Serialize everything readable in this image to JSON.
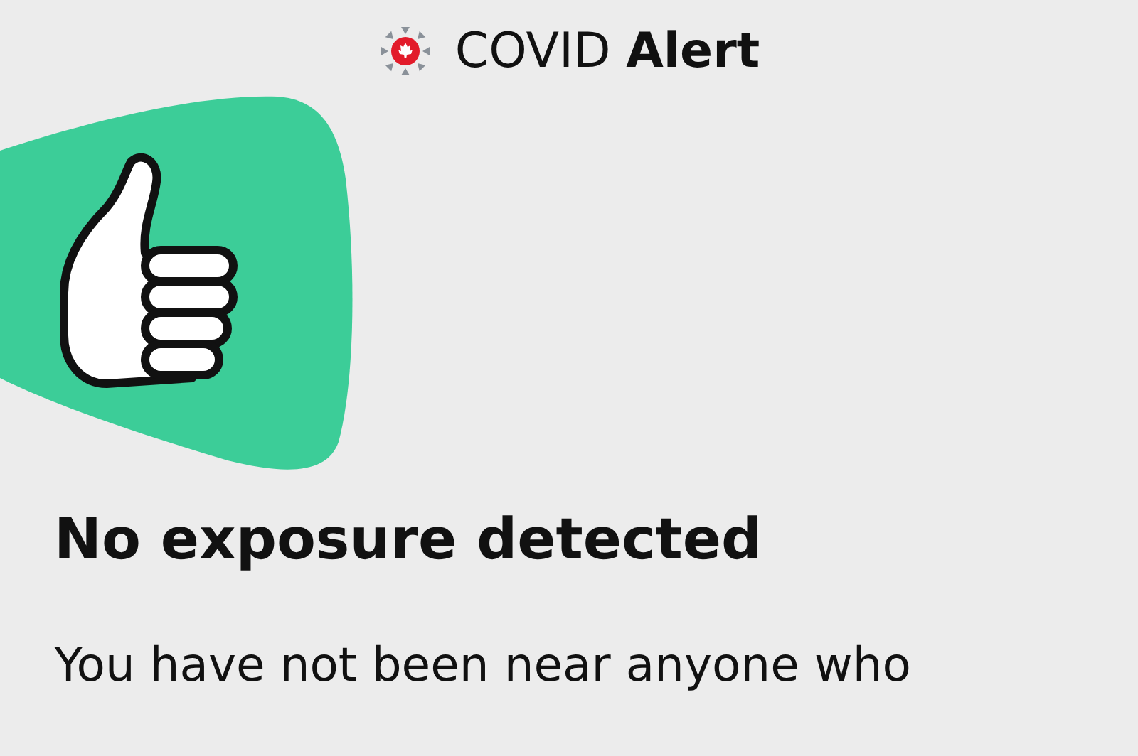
{
  "header": {
    "title": "COVID **Alert**"
  },
  "status": {
    "kind": "no_exposure",
    "heading": "No exposure detected",
    "message": "You have not been near anyone who"
  }
}
